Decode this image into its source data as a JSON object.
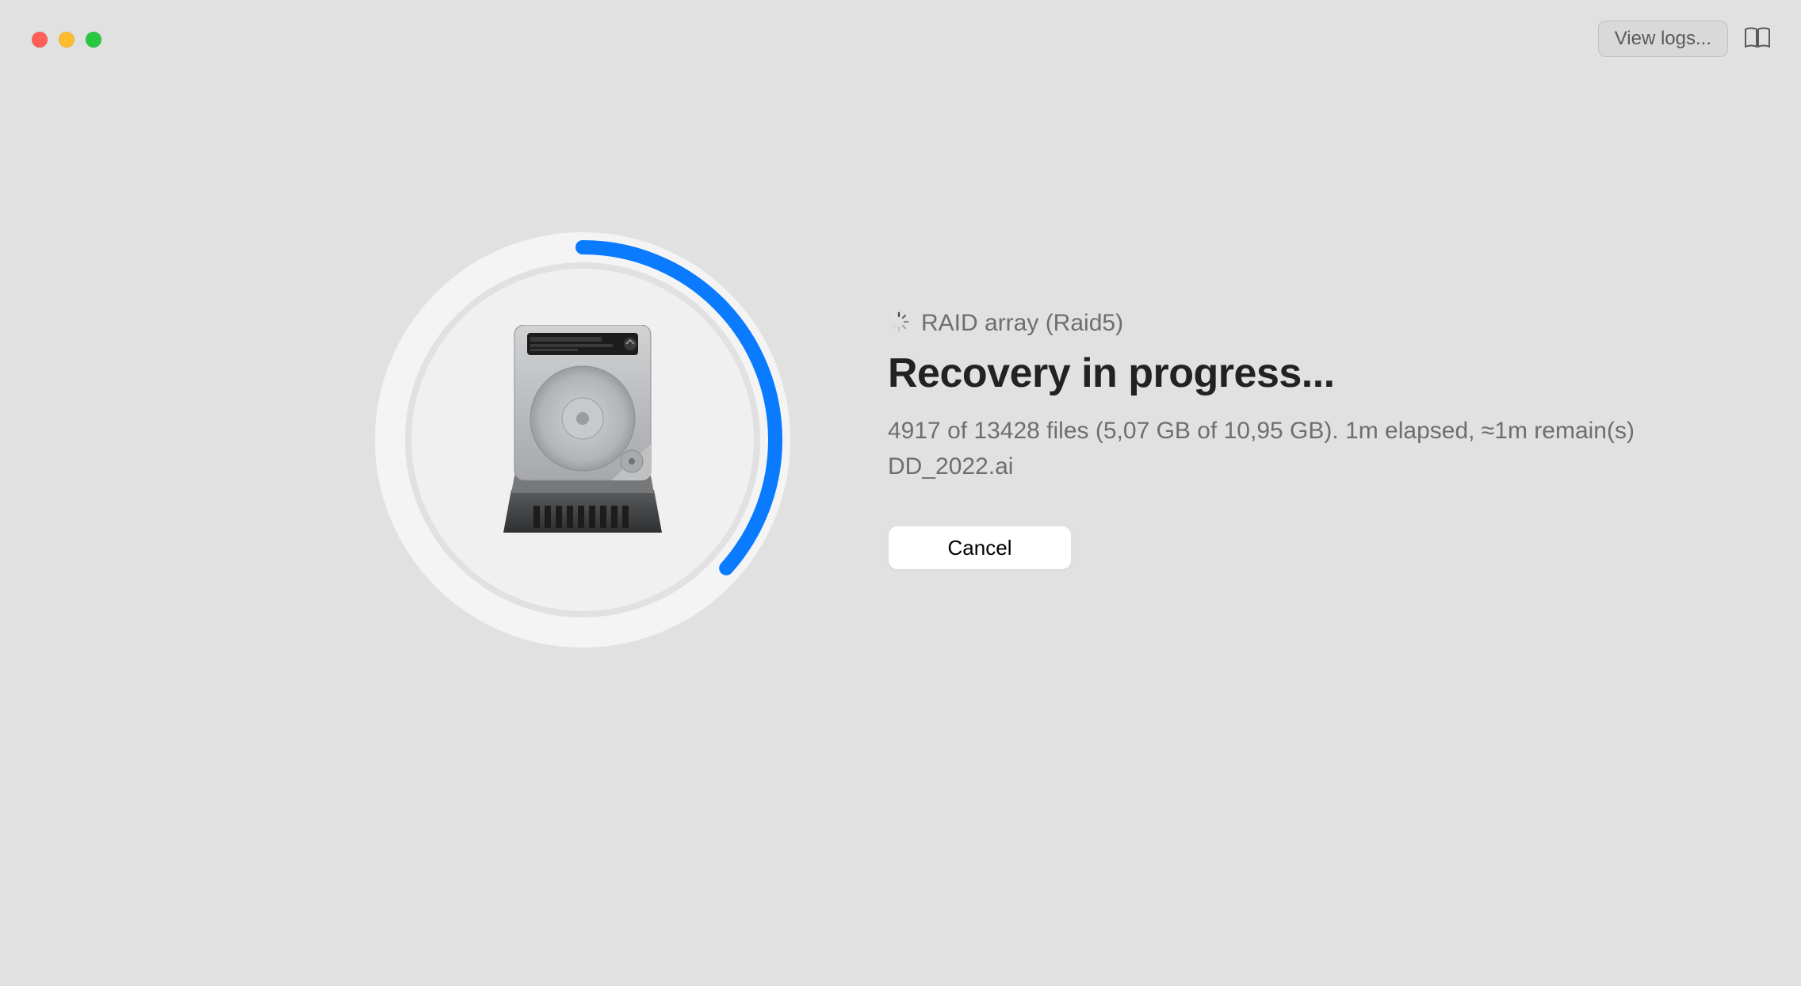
{
  "window": {
    "view_logs_label": "View logs..."
  },
  "progress": {
    "percent": 36.6,
    "source_label": "RAID array (Raid5)",
    "title": "Recovery in progress...",
    "stats_line": "4917 of 13428 files (5,07 GB of 10,95 GB). 1m elapsed, ≈1m remain(s)",
    "current_file": "DD_2022.ai",
    "cancel_label": "Cancel",
    "accent_color": "#0a7aff"
  }
}
